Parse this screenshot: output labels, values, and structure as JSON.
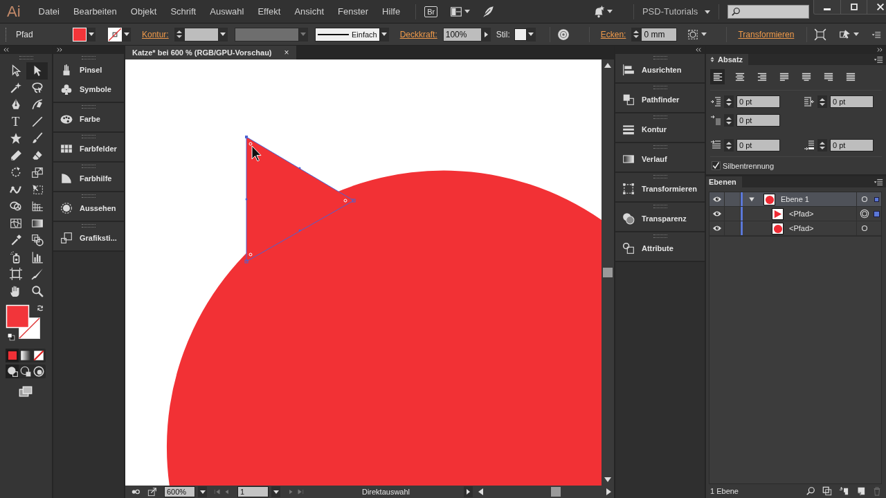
{
  "menu_bar": {
    "logo": "Ai",
    "items": [
      "Datei",
      "Bearbeiten",
      "Objekt",
      "Schrift",
      "Auswahl",
      "Effekt",
      "Ansicht",
      "Fenster",
      "Hilfe"
    ],
    "bridge": "Br",
    "workspace": "PSD-Tutorials"
  },
  "control_bar": {
    "selection_type": "Pfad",
    "stroke_label": "Kontur:",
    "stroke_profile": "Einfach",
    "opacity_label": "Deckkraft:",
    "opacity": "100%",
    "style_label": "Stil:",
    "corners_label": "Ecken:",
    "corners": "0 mm",
    "transform_link": "Transformieren"
  },
  "tools": [
    {
      "kind": "selection",
      "selected": false
    },
    {
      "kind": "direct",
      "selected": true
    },
    {
      "kind": "wand",
      "selected": false
    },
    {
      "kind": "lasso",
      "selected": false
    },
    {
      "kind": "pen",
      "selected": false
    },
    {
      "kind": "curvature",
      "selected": false
    },
    {
      "kind": "type",
      "glyph": "T",
      "selected": false
    },
    {
      "kind": "line",
      "selected": false
    },
    {
      "kind": "star",
      "selected": false
    },
    {
      "kind": "brush",
      "selected": false
    },
    {
      "kind": "pencil",
      "selected": false
    },
    {
      "kind": "eraser",
      "selected": false
    },
    {
      "kind": "rotate",
      "selected": false
    },
    {
      "kind": "scale",
      "selected": false
    },
    {
      "kind": "warp",
      "selected": false
    },
    {
      "kind": "freetransform",
      "selected": false
    },
    {
      "kind": "shapebuilder",
      "selected": false
    },
    {
      "kind": "perspective",
      "selected": false
    },
    {
      "kind": "mesh",
      "selected": false
    },
    {
      "kind": "gradient",
      "selected": false
    },
    {
      "kind": "eyedropper",
      "selected": false
    },
    {
      "kind": "blend",
      "selected": false
    },
    {
      "kind": "sprayer",
      "selected": false
    },
    {
      "kind": "graph",
      "selected": false
    },
    {
      "kind": "artboard",
      "selected": false
    },
    {
      "kind": "knife",
      "selected": false
    },
    {
      "kind": "hand",
      "selected": false
    },
    {
      "kind": "zoom",
      "selected": false
    }
  ],
  "left_dock": [
    {
      "items": [
        {
          "kind": "brushes",
          "label": "Pinsel"
        },
        {
          "kind": "symbols",
          "label": "Symbole"
        }
      ]
    },
    {
      "items": [
        {
          "kind": "color",
          "label": "Farbe"
        }
      ]
    },
    {
      "items": [
        {
          "kind": "swatches",
          "label": "Farbfelder"
        }
      ]
    },
    {
      "items": [
        {
          "kind": "guide",
          "label": "Farbhilfe"
        }
      ]
    },
    {
      "items": [
        {
          "kind": "appearance",
          "label": "Aussehen"
        }
      ]
    },
    {
      "items": [
        {
          "kind": "styles",
          "label": "Grafiksti..."
        }
      ]
    }
  ],
  "document": {
    "tab": "Katze* bei 600 % (RGB/GPU-Vorschau)",
    "close": "×",
    "zoom": "600%",
    "artboard": "1",
    "status": "Direktauswahl"
  },
  "right_dock": [
    {
      "kind": "align",
      "label": "Ausrichten"
    },
    {
      "kind": "pathfinder",
      "label": "Pathfinder"
    },
    {
      "kind": "stroke",
      "label": "Kontur"
    },
    {
      "kind": "gradientpanel",
      "label": "Verlauf"
    },
    {
      "kind": "transform",
      "label": "Transformieren"
    },
    {
      "kind": "transparency",
      "label": "Transparenz"
    },
    {
      "kind": "attributes",
      "label": "Attribute"
    }
  ],
  "paragraph_panel": {
    "title": "Absatz",
    "alignments": [
      {
        "kind": "left",
        "selected": true
      },
      {
        "kind": "center",
        "selected": false
      },
      {
        "kind": "right",
        "selected": false
      },
      {
        "kind": "justify-left",
        "selected": false
      },
      {
        "kind": "justify-center",
        "selected": false
      },
      {
        "kind": "justify-right",
        "selected": false
      },
      {
        "kind": "justify-all",
        "selected": false
      }
    ],
    "indents": [
      {
        "kind": "left-indent",
        "value": "0 pt"
      },
      {
        "kind": "right-indent",
        "value": "0 pt"
      },
      {
        "kind": "first-line",
        "value": "0 pt"
      },
      {
        "kind": "space-before",
        "value": "0 pt"
      },
      {
        "kind": "space-after",
        "value": "0 pt"
      }
    ],
    "hyphenation": {
      "label": "Silbentrennung",
      "checked": true
    }
  },
  "layers_panel": {
    "title": "Ebenen",
    "layers": [
      {
        "name": "Ebene 1",
        "kind": "circle",
        "visible": true,
        "expanded": true,
        "current": true,
        "targeted": false,
        "selected": true,
        "children": [
          {
            "name": "<Pfad>",
            "kind": "triangle",
            "visible": true,
            "targeted": true,
            "selected": true
          },
          {
            "name": "<Pfad>",
            "kind": "circle",
            "visible": true,
            "targeted": false,
            "selected": false
          }
        ]
      }
    ],
    "footer": "1 Ebene"
  }
}
